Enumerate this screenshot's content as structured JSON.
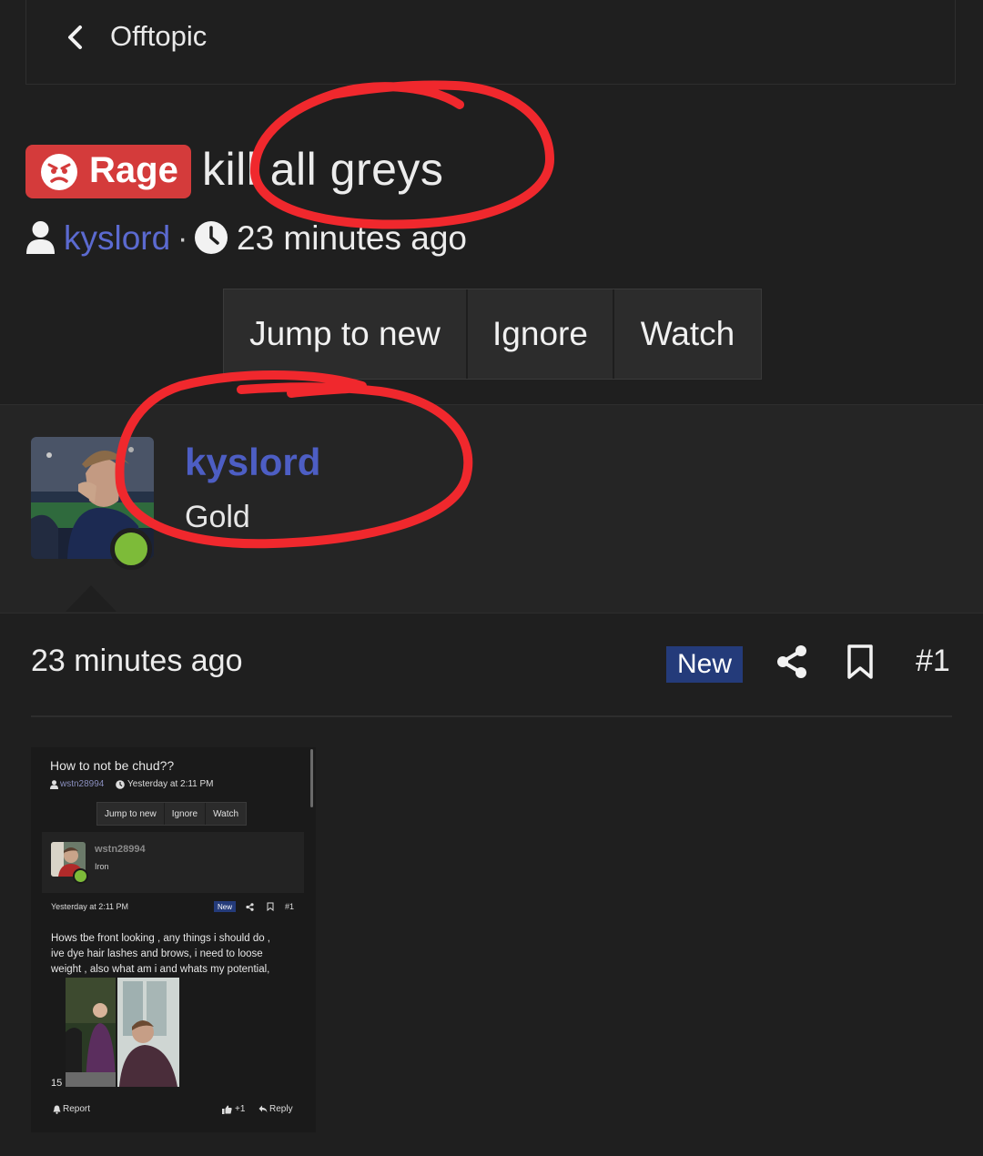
{
  "nav": {
    "back_icon": "chevron-left-icon",
    "title": "Offtopic"
  },
  "thread": {
    "prefix": {
      "label": "Rage",
      "icon": "angry-face-icon",
      "color": "#d43b3b"
    },
    "title": "kill all greys",
    "author": "kyslord",
    "separator": "·",
    "time": "23 minutes ago"
  },
  "actions": [
    "Jump to new",
    "Ignore",
    "Watch"
  ],
  "post": {
    "author": "kyslord",
    "user_title": "Gold",
    "status": "online",
    "date": "23 minutes ago",
    "badge": "New",
    "number": "#1"
  },
  "embedded_screenshot": {
    "title": "How to not be chud??",
    "author": "wstn28994",
    "time": "Yesterday at 2:11 PM",
    "actions": [
      "Jump to new",
      "Ignore",
      "Watch"
    ],
    "post_author": "wstn28994",
    "user_title": "Iron",
    "post_date": "Yesterday at 2:11 PM",
    "badge": "New",
    "number": "#1",
    "body_lines": [
      "Hows tbe front looking , any things i should do ,",
      "ive dye hair lashes and brows, i need to loose",
      "weight , also what am i and whats my potential,"
    ],
    "image_count": "15",
    "report": "Report",
    "like": "+1",
    "reply": "Reply"
  },
  "colors": {
    "accent": "#4d5ec4",
    "badge": "#243b7a",
    "online": "#7dbb39",
    "annotation": "#f0282d"
  }
}
